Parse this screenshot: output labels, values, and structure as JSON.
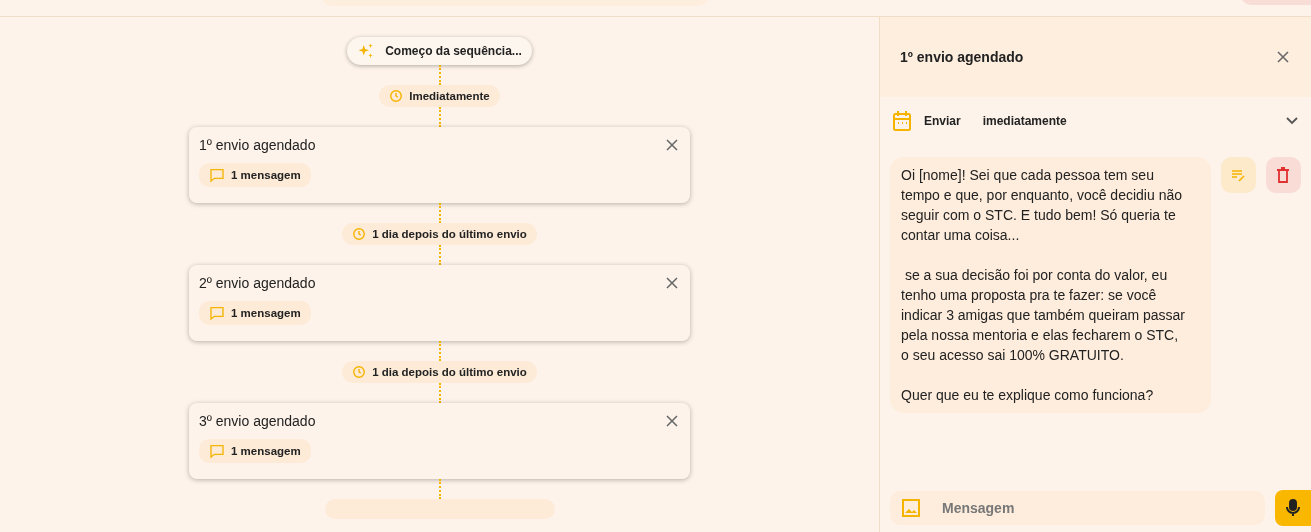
{
  "sequence": {
    "start": {
      "label": "Começo da sequência..."
    },
    "steps": [
      {
        "delay": "Imediatamente",
        "title": "1º envio agendado",
        "messages": "1 mensagem"
      },
      {
        "delay": "1 dia depois do último envio",
        "title": "2º envio agendado",
        "messages": "1 mensagem"
      },
      {
        "delay": "1 dia depois do último envio",
        "title": "3º envio agendado",
        "messages": "1 mensagem"
      }
    ]
  },
  "panel": {
    "title": "1º envio agendado",
    "schedule_label": "Enviar",
    "schedule_value": "imediatamente",
    "message": "Oi [nome]! Sei que cada pessoa tem seu tempo e que, por enquanto, você decidiu não seguir com o STC. E tudo bem! Só queria te contar uma coisa...\n\n se a sua decisão foi por conta do valor, eu tenho uma proposta pra te fazer: se você indicar 3 amigas que também queiram passar pela nossa mentoria e elas fecharem o STC, o seu acesso sai 100% GRATUITO.\n\nQuer que eu te explique como funciona?",
    "composer": {
      "placeholder": "Mensagem"
    }
  }
}
